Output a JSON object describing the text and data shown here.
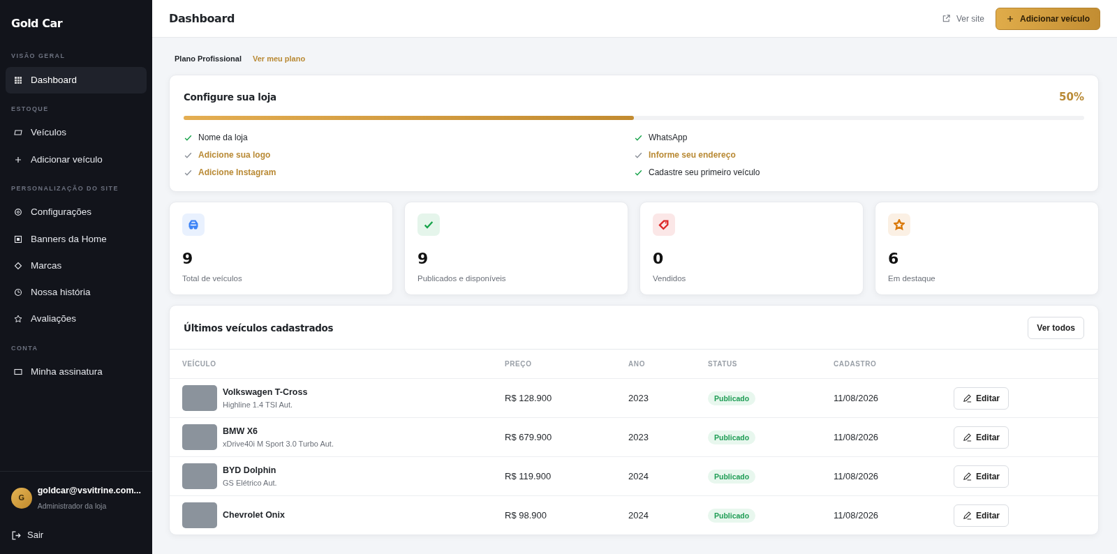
{
  "sidebar": {
    "brand": "Gold Car",
    "sections": [
      {
        "title": "VISÃO GERAL",
        "items": [
          {
            "label": "Dashboard",
            "kind": "grid",
            "selected": true
          }
        ]
      },
      {
        "title": "ESTOQUE",
        "items": [
          {
            "label": "Veículos",
            "kind": "card",
            "selected": false
          },
          {
            "label": "Adicionar veículo",
            "kind": "plus",
            "selected": false
          }
        ]
      },
      {
        "title": "PERSONALIZAÇÃO DO SITE",
        "items": [
          {
            "label": "Configurações",
            "kind": "gear",
            "selected": false
          },
          {
            "label": "Banners da Home",
            "kind": "banner",
            "selected": false
          },
          {
            "label": "Marcas",
            "kind": "diamond",
            "selected": false
          },
          {
            "label": "Nossa história",
            "kind": "clock",
            "selected": false
          },
          {
            "label": "Avaliações",
            "kind": "star",
            "selected": false
          }
        ]
      },
      {
        "title": "CONTA",
        "items": [
          {
            "label": "Minha assinatura",
            "kind": "rect",
            "selected": false
          }
        ]
      }
    ],
    "user": {
      "avatar": "G",
      "email": "goldcar@vsvitrine.com...",
      "role": "Administrador da loja"
    },
    "logout": "Sair"
  },
  "header": {
    "title": "Dashboard",
    "view_site": "Ver site",
    "add_button": "Adicionar veículo"
  },
  "plan": {
    "name": "Plano Profissional",
    "link": "Ver meu plano"
  },
  "setup": {
    "title": "Configure sua loja",
    "percent": "50%",
    "level": 0.5,
    "tasks": [
      {
        "label": "Nome da loja",
        "done": true
      },
      {
        "label": "WhatsApp",
        "done": true
      },
      {
        "label": "Adicione sua logo",
        "done": false
      },
      {
        "label": "Informe seu endereço",
        "done": false
      },
      {
        "label": "Adicione Instagram",
        "done": false
      },
      {
        "label": "Cadastre seu primeiro veículo",
        "done": true
      }
    ]
  },
  "stats": [
    {
      "kind": "car",
      "color": "#3b82f6",
      "value": "9",
      "label": "Total de veículos"
    },
    {
      "kind": "check",
      "color": "#16a34a",
      "value": "9",
      "label": "Publicados e disponíveis"
    },
    {
      "kind": "tag",
      "color": "#dc2626",
      "value": "0",
      "label": "Vendidos"
    },
    {
      "kind": "star",
      "color": "#d97706",
      "value": "6",
      "label": "Em destaque"
    }
  ],
  "latest": {
    "title": "Últimos veículos cadastrados",
    "view_all": "Ver todos",
    "columns": [
      "VEÍCULO",
      "PREÇO",
      "ANO",
      "STATUS",
      "CADASTRO"
    ],
    "rows": [
      {
        "name": "Volkswagen T-Cross",
        "version": "Highline 1.4 TSI Aut.",
        "price": "R$ 128.900",
        "year": "2023",
        "status": "Publicado",
        "date": "11/08/2026",
        "action": "Editar"
      },
      {
        "name": "BMW X6",
        "version": "xDrive40i M Sport 3.0 Turbo Aut.",
        "price": "R$ 679.900",
        "year": "2023",
        "status": "Publicado",
        "date": "11/08/2026",
        "action": "Editar"
      },
      {
        "name": "BYD Dolphin",
        "version": "GS Elétrico Aut.",
        "price": "R$ 119.900",
        "year": "2024",
        "status": "Publicado",
        "date": "11/08/2026",
        "action": "Editar"
      },
      {
        "name": "Chevrolet Onix",
        "price": "R$ 98.900",
        "year": "2024",
        "status": "Publicado",
        "date": "11/08/2026",
        "action": "Editar"
      }
    ]
  }
}
